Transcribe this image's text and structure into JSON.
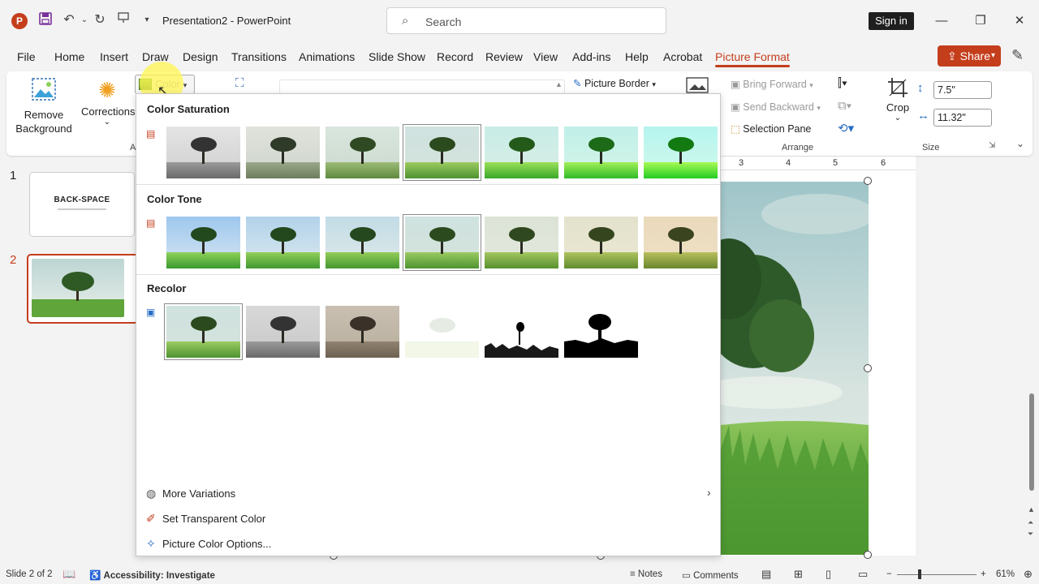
{
  "app": {
    "title": "Presentation2  -  PowerPoint",
    "search_placeholder": "Search",
    "sign_in": "Sign in",
    "share": "Share"
  },
  "menu": {
    "tabs": [
      "File",
      "Home",
      "Insert",
      "Draw",
      "Design",
      "Transitions",
      "Animations",
      "Slide Show",
      "Record",
      "Review",
      "View",
      "Add-ins",
      "Help",
      "Acrobat",
      "Picture Format"
    ],
    "active_tab": "Picture Format"
  },
  "ribbon": {
    "remove_background": [
      "Remove",
      "Background"
    ],
    "corrections": "Corrections",
    "color": "Color",
    "group_label_adjust": "A",
    "picture_border": "Picture Border",
    "bring_forward": "Bring Forward",
    "send_backward": "Send Backward",
    "selection_pane": "Selection Pane",
    "arrange_label": "Arrange",
    "crop": "Crop",
    "height_value": "7.5\"",
    "width_value": "11.32\"",
    "size_label": "Size"
  },
  "ruler": {
    "ticks": [
      "3",
      "4",
      "5",
      "6"
    ]
  },
  "slides": {
    "numbers": [
      "1",
      "2"
    ],
    "slide1_title": "BACK-SPACE",
    "selected": 2
  },
  "color_menu": {
    "sections": {
      "saturation": "Color Saturation",
      "tone": "Color Tone",
      "recolor": "Recolor"
    },
    "items": {
      "more_variations": "More Variations",
      "set_transparent": "Set Transparent Color",
      "picture_color_options": "Picture Color Options..."
    },
    "selected_saturation_index": 3,
    "selected_tone_index": 3,
    "selected_recolor_index": 0
  },
  "status": {
    "slide_of": "Slide 2 of 2",
    "accessibility": "Accessibility: Investigate",
    "notes": "Notes",
    "comments": "Comments",
    "zoom": "61%"
  },
  "colors": {
    "accent": "#c43e1c",
    "ribbon_bg": "#ffffff",
    "app_bg": "#f3f3f3"
  }
}
